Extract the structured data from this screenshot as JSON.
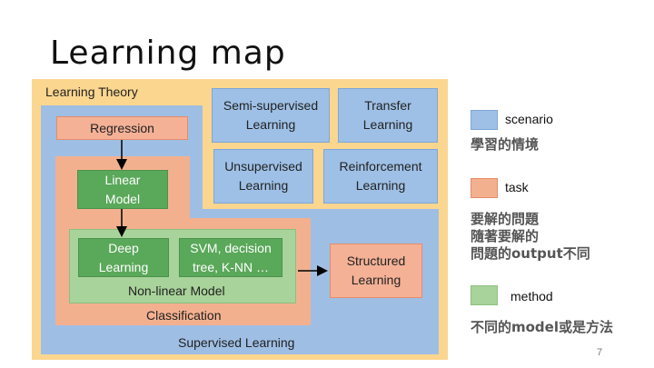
{
  "title": "Learning map",
  "diagram": {
    "learning_theory": "Learning Theory",
    "supervised_learning": "Supervised Learning",
    "semi_supervised": "Semi-supervised\nLearning",
    "transfer": "Transfer\nLearning",
    "unsupervised": "Unsupervised\nLearning",
    "reinforcement": "Reinforcement\nLearning",
    "regression": "Regression",
    "linear_model": "Linear\nModel",
    "deep_learning": "Deep\nLearning",
    "svm": "SVM, decision\ntree, K-NN …",
    "non_linear_model": "Non-linear Model",
    "classification": "Classification",
    "structured_learning": "Structured\nLearning"
  },
  "legend": {
    "scenario": {
      "label": "scenario",
      "desc": "學習的情境",
      "color": "#9ec0e6"
    },
    "task": {
      "label": "task",
      "desc": "要解的問題\n隨著要解的\n問題的output不同",
      "color": "#f3b08f"
    },
    "method": {
      "label": "method",
      "desc": "不同的model或是方法",
      "color": "#a8d39a"
    }
  },
  "page_number": "7",
  "colors": {
    "theory_bg": "#fbd68f",
    "scenario": "#9ec0e6",
    "task": "#f3b08f",
    "method": "#a8d39a",
    "method_dark": "#5aa85a"
  }
}
